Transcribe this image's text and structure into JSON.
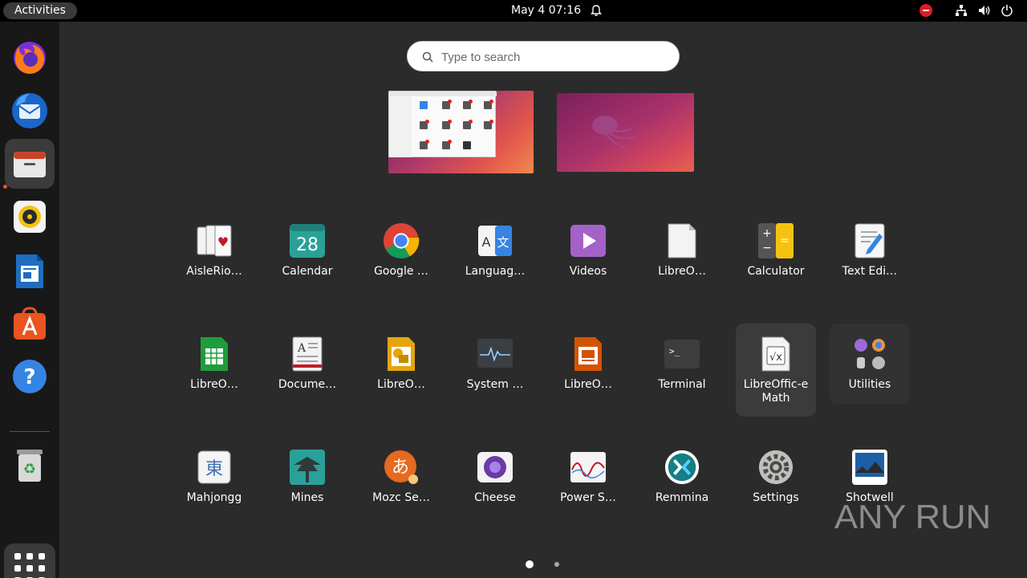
{
  "topbar": {
    "activities": "Activities",
    "clock": "May 4  07:16"
  },
  "search": {
    "placeholder": "Type to search"
  },
  "dock": {
    "items": [
      "Firefox",
      "Thunderbird",
      "Files",
      "Rhythmbox",
      "LibreOffice Writer",
      "Ubuntu Software",
      "Help",
      "Trash",
      "Show Applications"
    ]
  },
  "apps": [
    {
      "label": "AisleRio…",
      "icon": "cards-icon"
    },
    {
      "label": "Calendar",
      "icon": "calendar-icon",
      "icon_text": "28"
    },
    {
      "label": "Google …",
      "icon": "chrome-icon"
    },
    {
      "label": "Languag…",
      "icon": "language-icon",
      "icon_text": "A",
      "icon_text2": "文"
    },
    {
      "label": "Videos",
      "icon": "videos-icon"
    },
    {
      "label": "LibreO…",
      "icon": "libreoffice-icon"
    },
    {
      "label": "Calculator",
      "icon": "calculator-icon"
    },
    {
      "label": "Text Edi…",
      "icon": "text-editor-icon"
    },
    {
      "label": "LibreO…",
      "icon": "libreoffice-calc-icon"
    },
    {
      "label": "Docume…",
      "icon": "document-viewer-icon"
    },
    {
      "label": "LibreO…",
      "icon": "libreoffice-draw-icon"
    },
    {
      "label": "System …",
      "icon": "system-monitor-icon"
    },
    {
      "label": "LibreO…",
      "icon": "libreoffice-impress-icon"
    },
    {
      "label": "Terminal",
      "icon": "terminal-icon"
    },
    {
      "label": "LibreOffic-e Math",
      "icon": "libreoffice-math-icon"
    },
    {
      "label": "Utilities",
      "icon": "utilities-folder-icon"
    },
    {
      "label": "Mahjongg",
      "icon": "mahjongg-icon",
      "icon_text": "東"
    },
    {
      "label": "Mines",
      "icon": "mines-icon"
    },
    {
      "label": "Mozc Se…",
      "icon": "mozc-icon",
      "icon_text": "あ"
    },
    {
      "label": "Cheese",
      "icon": "cheese-icon"
    },
    {
      "label": "Power S…",
      "icon": "power-statistics-icon"
    },
    {
      "label": "Remmina",
      "icon": "remmina-icon"
    },
    {
      "label": "Settings",
      "icon": "settings-icon"
    },
    {
      "label": "Shotwell",
      "icon": "shotwell-icon"
    }
  ],
  "pages": {
    "current": 1,
    "total": 2
  },
  "watermark": {
    "text": "ANY RUN"
  }
}
